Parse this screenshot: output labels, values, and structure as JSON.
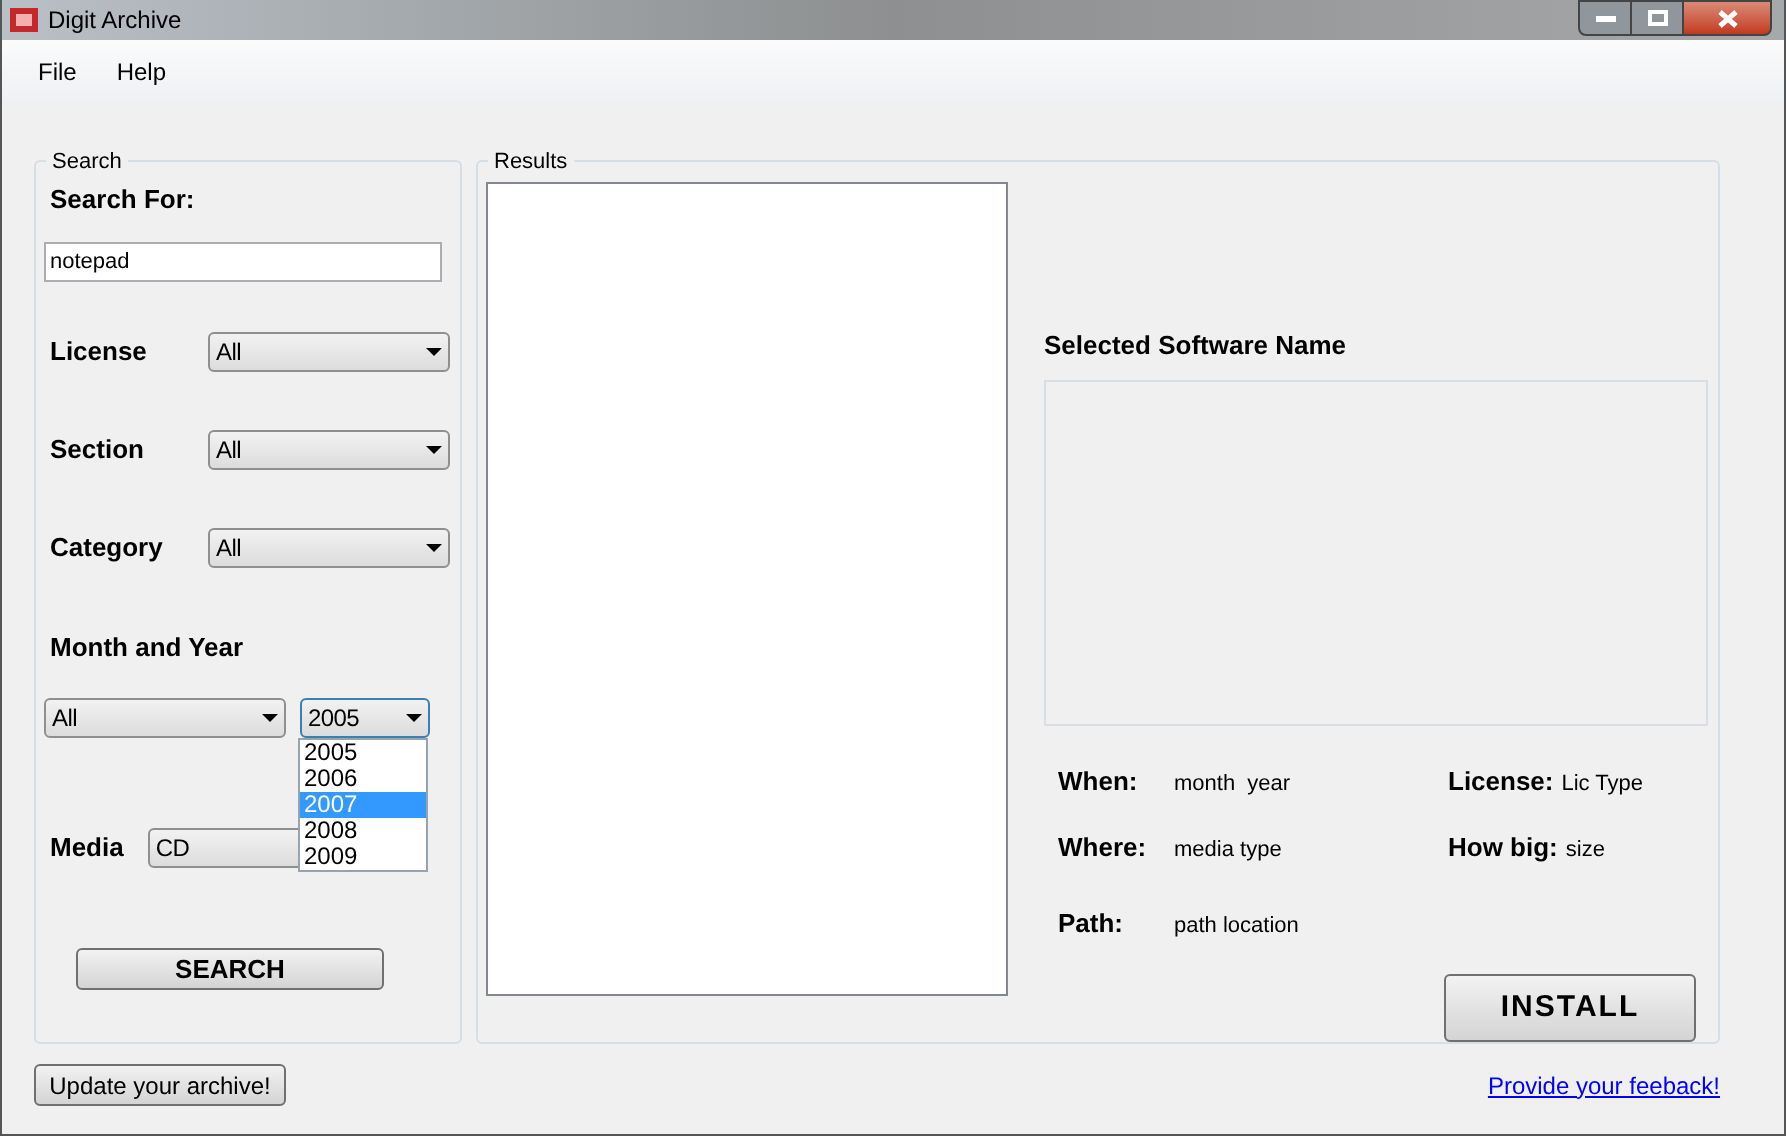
{
  "window": {
    "title": "Digit Archive"
  },
  "menu": [
    "File",
    "Help"
  ],
  "search": {
    "legend": "Search",
    "search_for_label": "Search For:",
    "query": "notepad",
    "filters": [
      {
        "label": "License",
        "value": "All"
      },
      {
        "label": "Section",
        "value": "All"
      },
      {
        "label": "Category",
        "value": "All"
      }
    ],
    "month_year_label": "Month and Year",
    "month": "All",
    "year": "2005",
    "year_options": [
      {
        "label": "2005",
        "selected": false
      },
      {
        "label": "2006",
        "selected": false
      },
      {
        "label": "2007",
        "selected": true
      },
      {
        "label": "2008",
        "selected": false
      },
      {
        "label": "2009",
        "selected": false
      }
    ],
    "media_label": "Media",
    "media": "CD",
    "button": "SEARCH"
  },
  "results": {
    "legend": "Results",
    "selected_name_label": "Selected Software Name",
    "details": [
      {
        "label": "When:",
        "value": "month  year"
      },
      {
        "label": "License:",
        "value": "Lic Type"
      },
      {
        "label": "Where:",
        "value": "media type"
      },
      {
        "label": "How big:",
        "value": "size"
      },
      {
        "label": "Path:",
        "value": "path location"
      }
    ],
    "install_button": "INSTALL"
  },
  "footer": {
    "update_button": "Update your archive!",
    "feedback_link": "Provide your feeback!"
  }
}
